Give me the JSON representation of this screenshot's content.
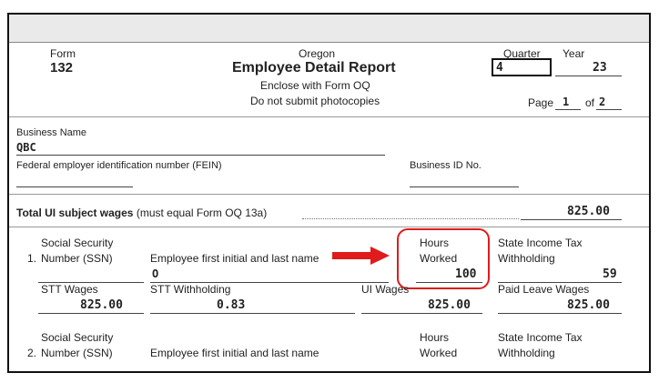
{
  "header": {
    "form_label": "Form",
    "form_number": "132",
    "state": "Oregon",
    "title": "Employee Detail Report",
    "enclose": "Enclose with Form OQ",
    "no_photocopies": "Do not submit photocopies",
    "quarter_label": "Quarter",
    "quarter_value": "4",
    "year_label": "Year",
    "year_value": "23",
    "page_label": "Page",
    "page_value": "1",
    "of_label": "of",
    "of_value": "2"
  },
  "business": {
    "name_label": "Business Name",
    "name_value": "QBC",
    "fein_label": "Federal employer identification number (FEIN)",
    "bin_label": "Business ID No."
  },
  "total": {
    "label_bold": "Total UI subject wages",
    "label_note": "(must equal Form OQ 13a)",
    "value": "825.00"
  },
  "employees": [
    {
      "number": "1.",
      "ssn_label_1": "Social Security",
      "ssn_label_2": "Number (SSN)",
      "name_label": "Employee first initial and last name",
      "name_value": "O",
      "hours_label_1": "Hours",
      "hours_label_2": "Worked",
      "hours_value": "100",
      "sit_label_1": "State Income Tax",
      "sit_label_2": "Withholding",
      "sit_value": "59",
      "stt_wages_label": "STT Wages",
      "stt_wages_value": "825.00",
      "stt_withholding_label": "STT Withholding",
      "stt_withholding_value": "0.83",
      "ui_wages_label": "UI Wages",
      "ui_wages_value": "825.00",
      "paid_leave_label": "Paid Leave Wages",
      "paid_leave_value": "825.00"
    },
    {
      "number": "2.",
      "ssn_label_1": "Social Security",
      "ssn_label_2": "Number (SSN)",
      "name_label": "Employee first initial and last name",
      "hours_label_1": "Hours",
      "hours_label_2": "Worked",
      "sit_label_1": "State Income Tax",
      "sit_label_2": "Withholding"
    }
  ],
  "annotations": {
    "highlight_color": "#e01b1b",
    "arrow_icon": "right-arrow-icon"
  }
}
